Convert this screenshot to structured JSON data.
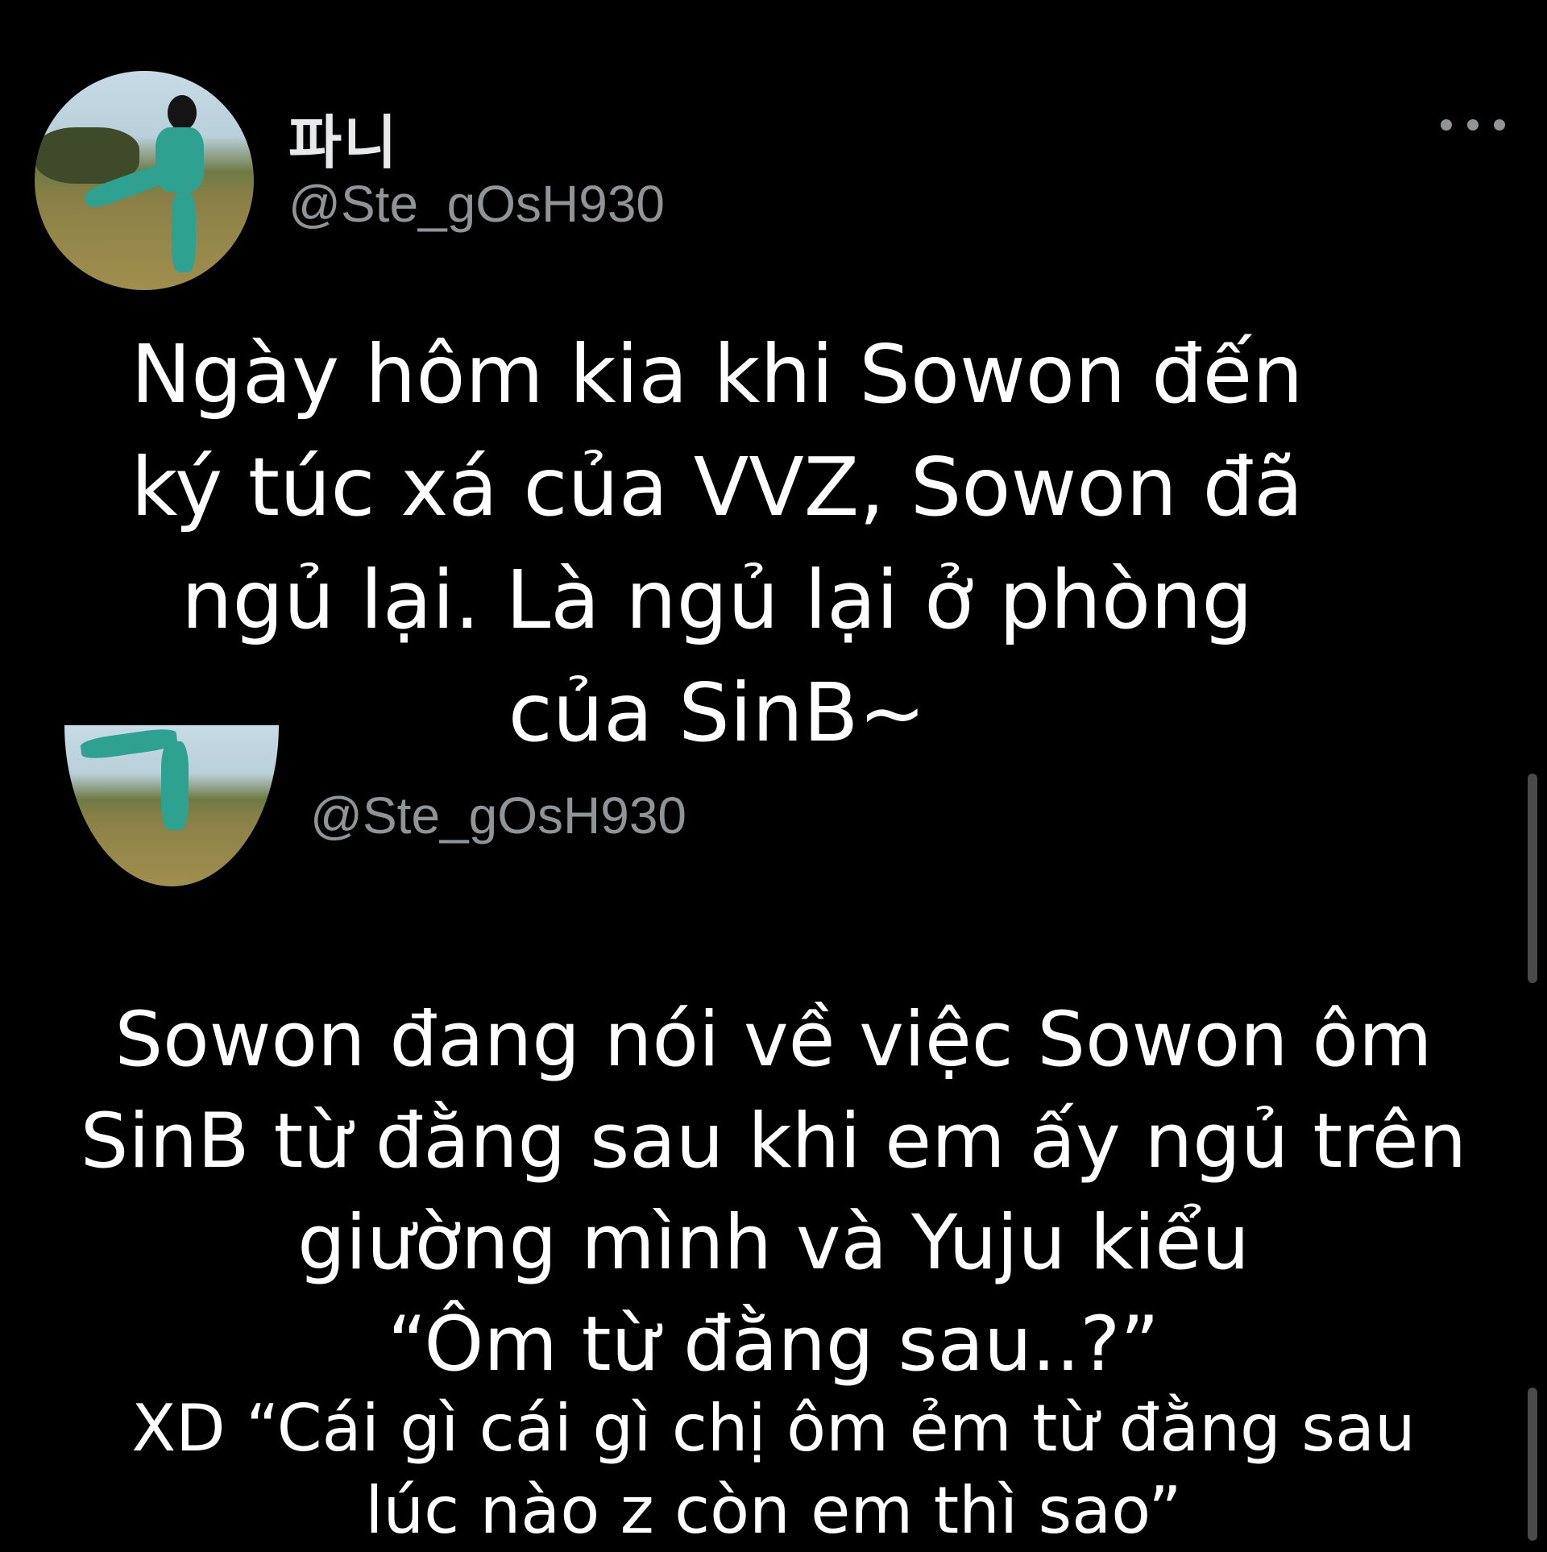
{
  "tweet": {
    "display_name": "파니",
    "handle": "@Ste_gOsH930",
    "more_icon": "more-horizontal-icon"
  },
  "quoted_tweet": {
    "handle": "@Ste_gOsH930"
  },
  "captions": {
    "first": "Ngày hôm kia khi Sowon đến\nký túc xá của VVZ, Sowon đã\nngủ lại. Là ngủ lại ở phòng\ncủa SinB~",
    "second": "Sowon đang nói về việc Sowon ôm\nSinB từ đằng sau khi em ấy ngủ trên\ngiường mình và Yuju kiểu\n“Ôm từ đằng sau..?”",
    "third": "XD “Cái gì cái gì chị ôm ẻm từ đằng sau\nlúc nào z còn em thì sao”"
  },
  "colors": {
    "background": "#000000",
    "handle": "#8f9499",
    "caption": "#ffffff"
  }
}
